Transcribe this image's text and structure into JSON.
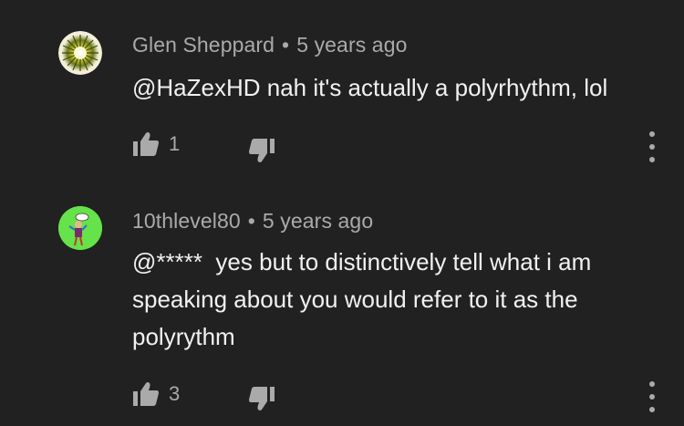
{
  "comments": [
    {
      "author": "Glen Sheppard",
      "separator": "•",
      "timestamp": "5 years ago",
      "text": "@HaZexHD nah it's actually a polyrhythm, lol",
      "likes": "1",
      "avatar_icon": "sunburst-avatar-icon"
    },
    {
      "author": "10thlevel80",
      "separator": "•",
      "timestamp": "5 years ago",
      "text": "@*****  yes but to distinctively tell what i am speaking about you would refer to it as the polyrythm",
      "likes": "3",
      "avatar_icon": "cartoon-figure-avatar-icon"
    }
  ],
  "colors": {
    "background": "#212121",
    "meta_text": "#aaaaaa",
    "body_text": "#f1f1f1",
    "avatar2_bg": "#66e24a"
  }
}
